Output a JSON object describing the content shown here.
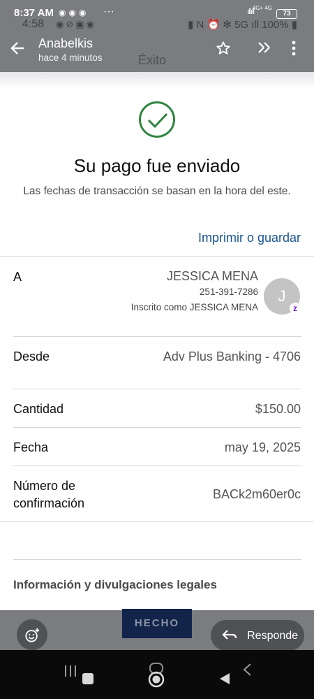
{
  "status_bar": {
    "time": "8:37 AM",
    "app_icons": "◉◉◉",
    "more": "···",
    "signal": "ıllıll",
    "network": "4G+\n4G",
    "battery": "73"
  },
  "status_bar_bg": {
    "time": "4:58",
    "app_icons": "◉⊘▣◉",
    "system": "▮ N ⏰ ✻ 5G ıll 100% ▮"
  },
  "app_bar": {
    "sender": "Anabelkis",
    "time_ago": "hace 4 minutos",
    "screen_title": "Éxito"
  },
  "payment": {
    "title": "Su pago fue enviado",
    "subtitle": "Las fechas de transacción se basan en la hora del este.",
    "print_link": "Imprimir o guardar",
    "to_label": "A",
    "recipient_name": "JESSICA MENA",
    "recipient_phone": "251-391-7286",
    "recipient_enrolled": "Inscrito como JESSICA MENA",
    "avatar_initial": "J",
    "zelle_badge": "z",
    "from_label": "Desde",
    "from_value": "Adv Plus Banking - 4706",
    "amount_label": "Cantidad",
    "amount_value": "$150.00",
    "date_label": "Fecha",
    "date_value": "may 19, 2025",
    "confirmation_label": "Número de confirmación",
    "confirmation_value": "BACk2m60er0c",
    "legal_heading": "Información y divulgaciones legales"
  },
  "footer": {
    "done_label": "HECHO",
    "reply_label": "Responde"
  },
  "colors": {
    "success_green": "#2e8540",
    "link_blue": "#1a5390",
    "overlay_gray": "#7a7c80",
    "done_navy": "#12244a"
  },
  "icons": {
    "back": "back-arrow-icon",
    "star": "star-icon",
    "forward": "forward-icon",
    "menu": "more-vert-icon",
    "check": "check-circle-icon",
    "emoji": "emoji-add-icon",
    "reply": "reply-icon"
  }
}
